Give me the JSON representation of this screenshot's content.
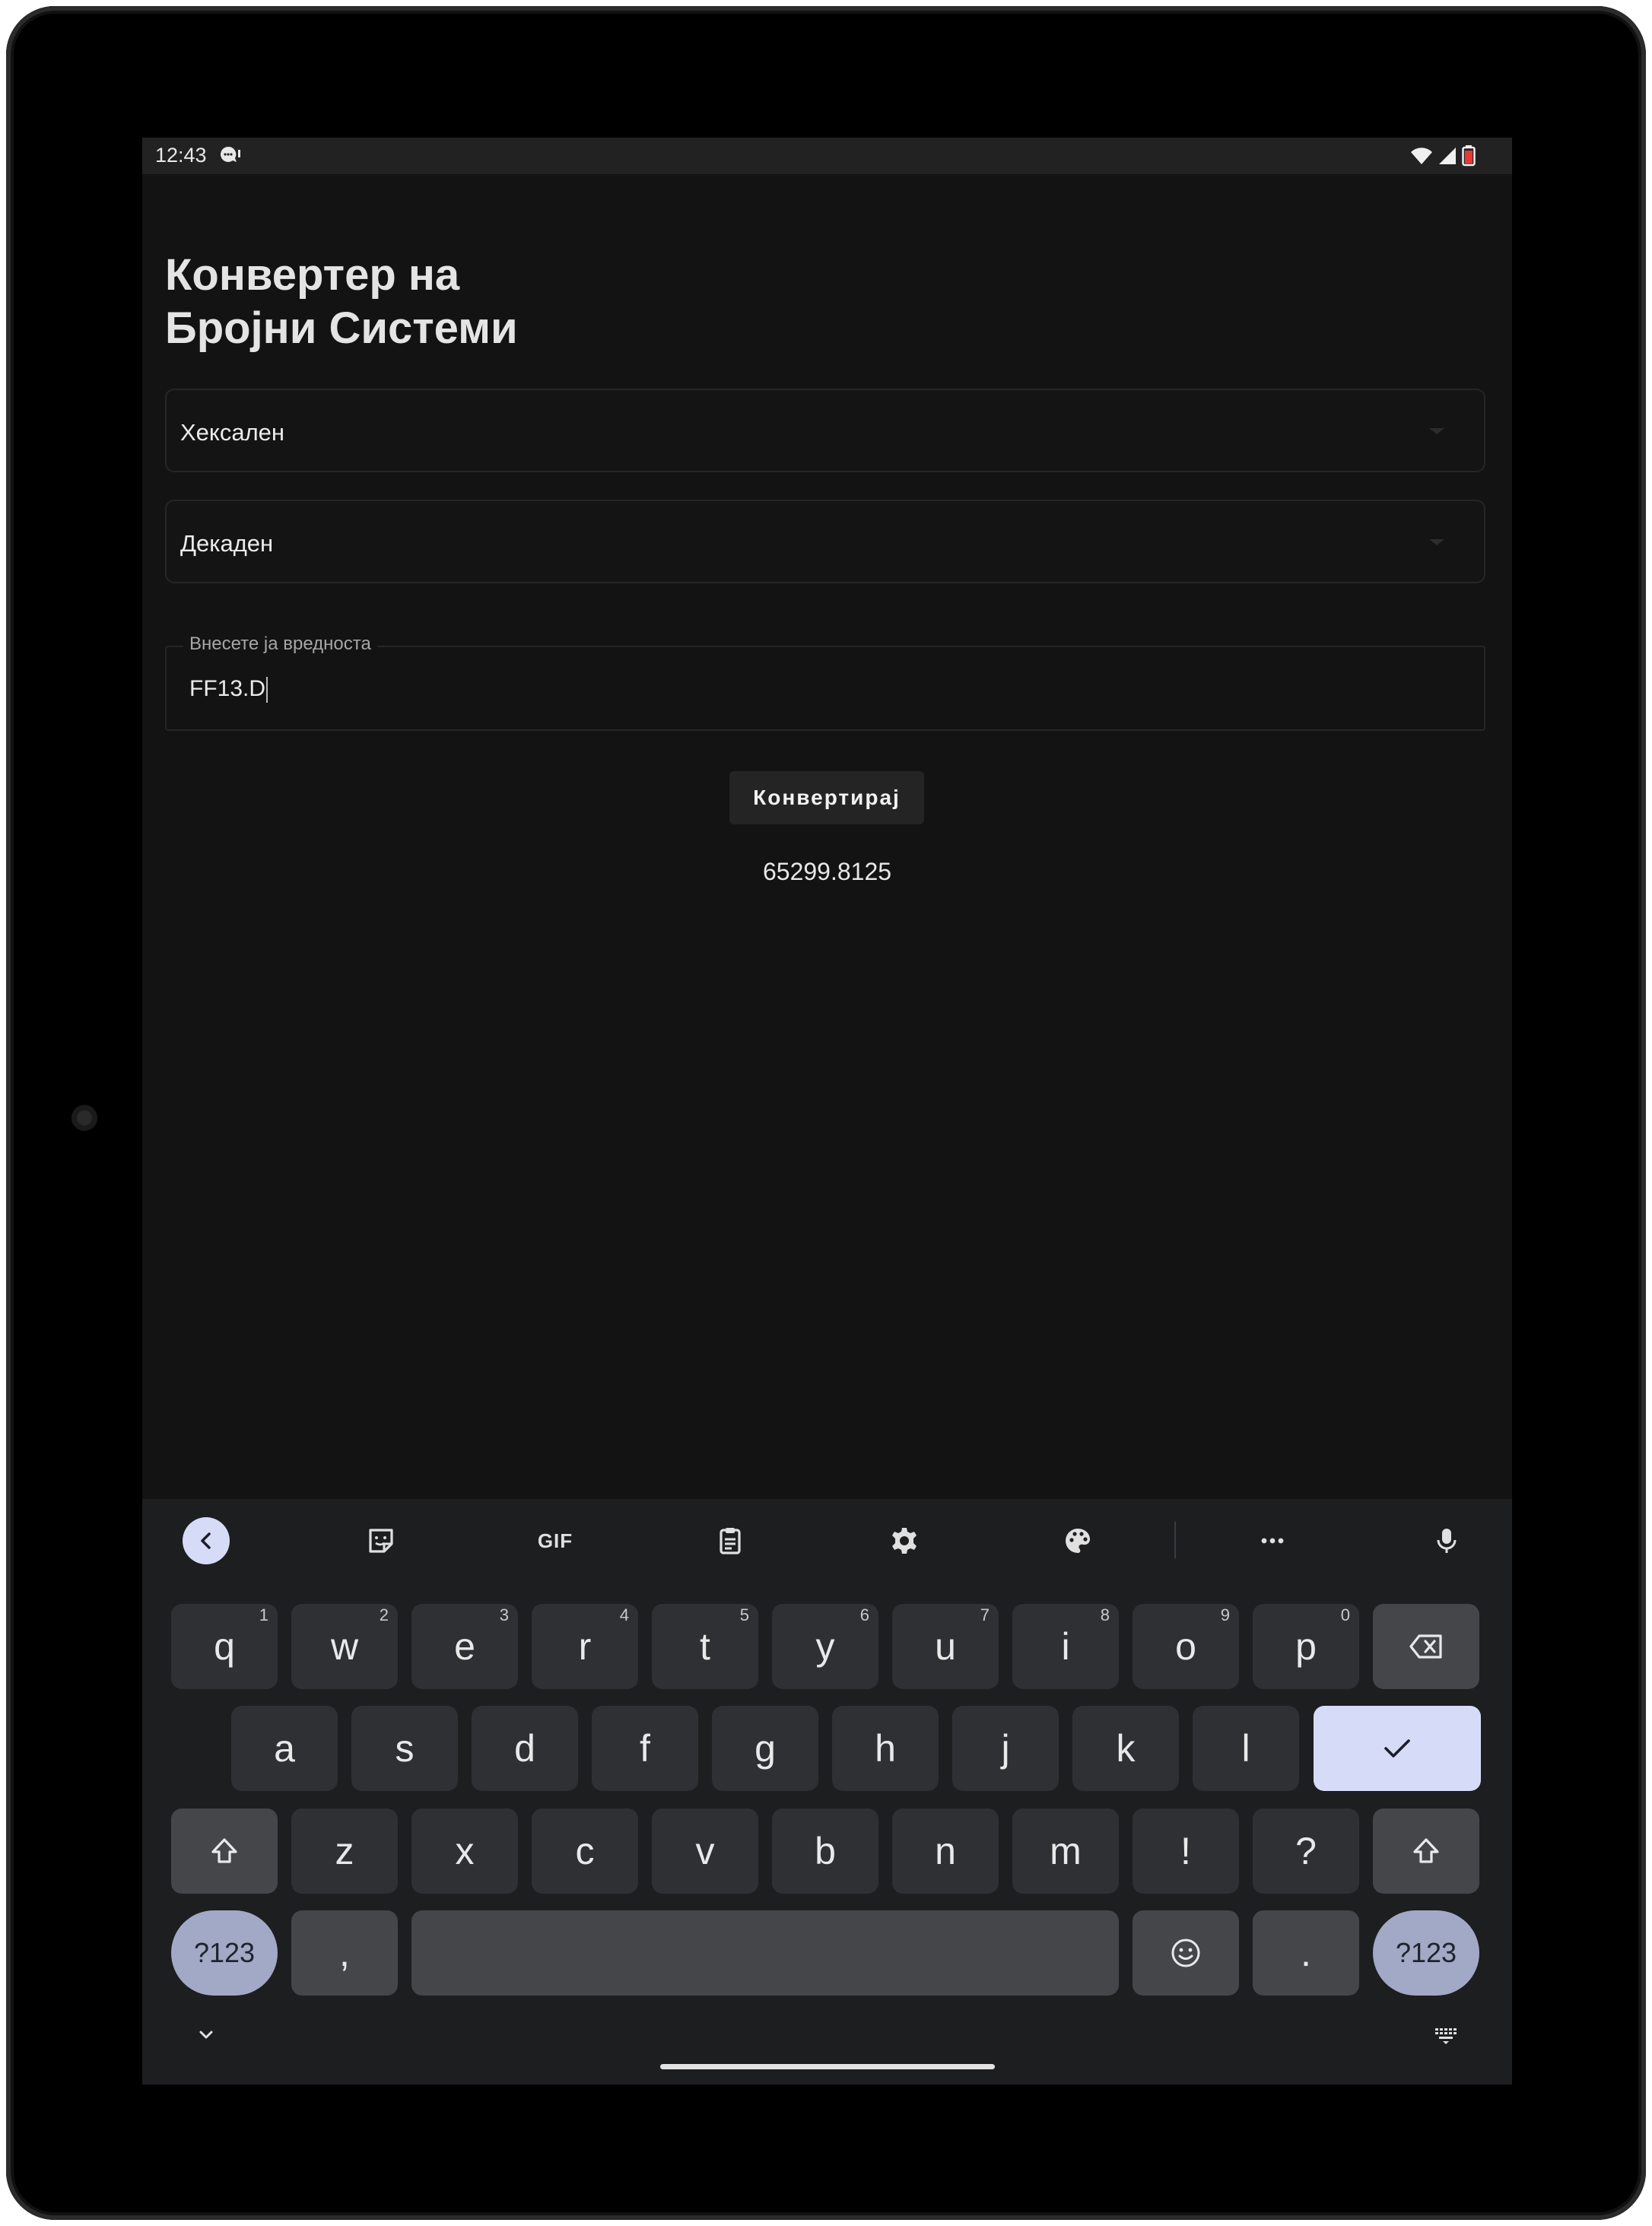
{
  "status_bar": {
    "time": "12:43",
    "icons": [
      "chat-notification-icon",
      "wifi-icon",
      "signal-icon",
      "battery-icon"
    ]
  },
  "app": {
    "title_line1": "Конвертер на",
    "title_line2": "Бројни Системи",
    "from_system": "Хексален",
    "to_system": "Декаден",
    "input_label": "Внесете ја вредноста",
    "input_value": "FF13.D",
    "convert_label": "Конвертирај",
    "result": "65299.8125"
  },
  "keyboard": {
    "toolbar": [
      "back-icon",
      "sticker-icon",
      "GIF",
      "clipboard-icon",
      "settings-icon",
      "palette-icon",
      "more-icon",
      "mic-icon"
    ],
    "gif_label": "GIF",
    "row1": [
      "q",
      "w",
      "e",
      "r",
      "t",
      "y",
      "u",
      "i",
      "o",
      "p"
    ],
    "row1_hints": [
      "1",
      "2",
      "3",
      "4",
      "5",
      "6",
      "7",
      "8",
      "9",
      "0"
    ],
    "row2": [
      "a",
      "s",
      "d",
      "f",
      "g",
      "h",
      "j",
      "k",
      "l"
    ],
    "row3": [
      "z",
      "x",
      "c",
      "v",
      "b",
      "n",
      "m",
      "!",
      "?"
    ],
    "symbols_label": "?123",
    "comma": ",",
    "period": "."
  },
  "colors": {
    "screen_bg": "#131313",
    "keyboard_bg": "#1d1e20",
    "key_bg": "#2f3033",
    "accent_key": "#d6dcf8",
    "pill_key": "#a2a9c6"
  }
}
